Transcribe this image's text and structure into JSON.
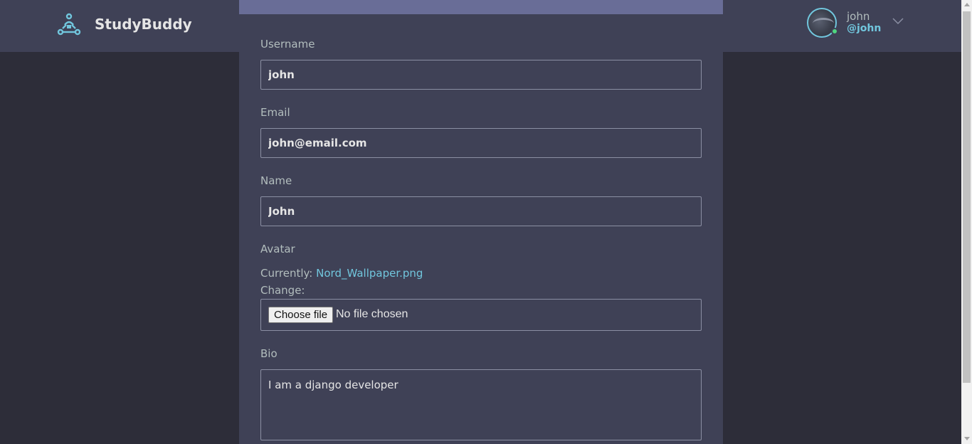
{
  "header": {
    "brand": "StudyBuddy",
    "logo_icon": "studybuddy-logo-icon",
    "user": {
      "name": "john",
      "handle": "@john",
      "dropdown_icon": "chevron-down-icon"
    }
  },
  "form": {
    "username": {
      "label": "Username",
      "value": "john"
    },
    "email": {
      "label": "Email",
      "value": "john@email.com"
    },
    "name": {
      "label": "Name",
      "value": "John"
    },
    "avatar": {
      "label": "Avatar",
      "currently_label": "Currently:",
      "current_file": "Nord_Wallpaper.png",
      "change_label": "Change:",
      "choose_button": "Choose file",
      "no_file_text": "No file chosen"
    },
    "bio": {
      "label": "Bio",
      "value": "I am a django developer"
    }
  },
  "colors": {
    "page_bg": "#2d2d39",
    "panel_bg": "#3f4156",
    "accent": "#71c6dd",
    "card_top": "#696d97",
    "online": "#4fd680"
  }
}
